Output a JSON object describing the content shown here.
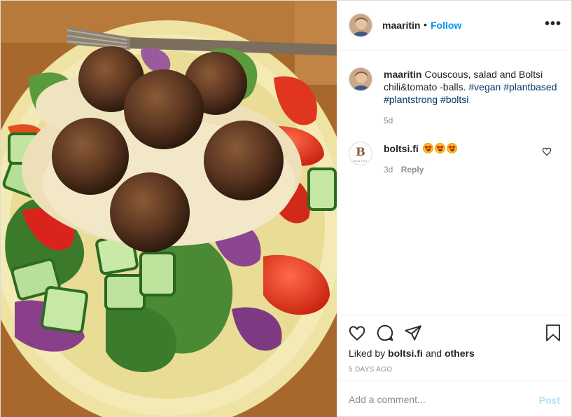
{
  "post": {
    "author": "maaritin",
    "dot": "•",
    "follow_label": "Follow",
    "more_icon": "more-horizontal-icon",
    "more_label": "•••"
  },
  "caption": {
    "username": "maaritin",
    "text": "Couscous, salad and Boltsi chili&tomato -balls.",
    "hashtags": [
      "#vegan",
      "#plantbased",
      "#plantstrong",
      "#boltsi"
    ],
    "time": "5d"
  },
  "comment": {
    "username": "boltsi.fi",
    "avatar_letter": "B",
    "avatar_word": "BOLTSI",
    "emoji_icon": "heart-eyes-emoji",
    "emoji_count": 3,
    "time": "3d",
    "reply_label": "Reply",
    "like_icon": "heart-outline-icon"
  },
  "actions": {
    "like_icon": "heart-outline-icon",
    "comment_icon": "comment-bubble-icon",
    "share_icon": "paper-plane-icon",
    "save_icon": "bookmark-icon",
    "liked_by_prefix": "Liked by",
    "liked_by_user": "boltsi.fi",
    "liked_by_and": "and",
    "liked_by_others": "others",
    "time_ago": "5 DAYS AGO"
  },
  "add_comment": {
    "placeholder": "Add a comment...",
    "post_label": "Post"
  },
  "colors": {
    "accent": "#0095f6",
    "hashtag": "#00376b",
    "muted": "#8e8e8e",
    "post_disabled": "#b2dffc"
  }
}
